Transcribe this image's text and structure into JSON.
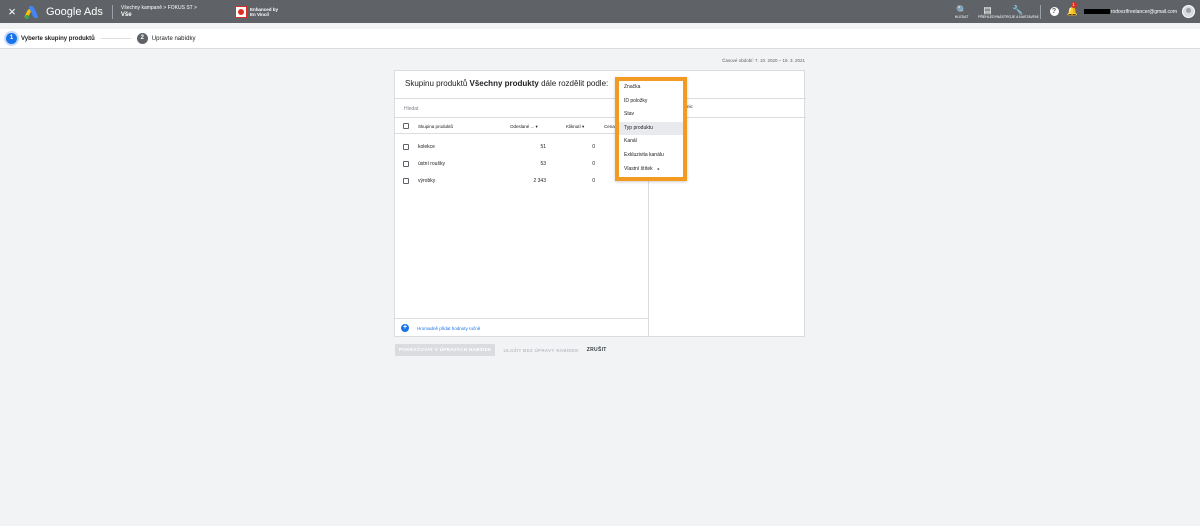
{
  "topbar": {
    "close_icon": "×",
    "brand": "Google Ads",
    "breadcrumb_path": "Všechny kampaně  >  FOKUS ST  >",
    "breadcrumb_current": "Vše",
    "extension_label_line1": "Enhanced by",
    "extension_label_line2": "En Vincíl",
    "tools": [
      {
        "icon": "search-icon",
        "glyph": "🔍",
        "label": "HLEDAT"
      },
      {
        "icon": "reports-icon",
        "glyph": "▤",
        "label": "PŘEHLEDY"
      },
      {
        "icon": "tools-icon",
        "glyph": "🔧",
        "label": "NÁSTROJE A NASTAVENÍ"
      }
    ],
    "help_glyph": "?",
    "notification_count": "1",
    "account_email": "rodovzlfreelancer@gmail.com"
  },
  "stepper": {
    "steps": [
      {
        "number": "1",
        "label": "Vyberte skupiny produktů",
        "active": true
      },
      {
        "number": "2",
        "label": "Upravte nabídky",
        "active": false
      }
    ]
  },
  "date_range": "Časové období: 7. 10. 2020 – 19. 3. 2021",
  "card": {
    "title_prefix": "Skupinu produktů ",
    "title_bold": "Všechny produkty",
    "title_suffix": " dále rozdělit podle:",
    "search_label": "Hledat",
    "columns": [
      "Skupina produktů",
      "Odeslané ... ▾",
      "Kliknutí ▾",
      "Cena"
    ],
    "rows": [
      {
        "name": "kolekce",
        "sent": "51",
        "clicks": "0"
      },
      {
        "name": "ústní roušky",
        "sent": "53",
        "clicks": "0"
      },
      {
        "name": "výrobky",
        "sent": "2 343",
        "clicks": "0"
      }
    ],
    "add_values_label": "Hromadně přidat hodnoty ručně",
    "right_column_label": "nic"
  },
  "buttons": {
    "continue": "POKRAČOVAT V ÚPRAVÁCH NABÍDEK",
    "save_without": "ULOŽIT BEZ ÚPRAVY NABÍDEK",
    "cancel": "ZRUŠIT"
  },
  "menu": {
    "highlight_color": "#f29a22",
    "items": [
      {
        "label": "Značka"
      },
      {
        "label": "ID položky"
      },
      {
        "label": "Stav"
      },
      {
        "label": "Typ produktu"
      },
      {
        "label": "Kanál"
      },
      {
        "label": "Exkluzivita kanálu"
      },
      {
        "label": "Vlastní štítek",
        "arrow": "▸"
      }
    ]
  }
}
